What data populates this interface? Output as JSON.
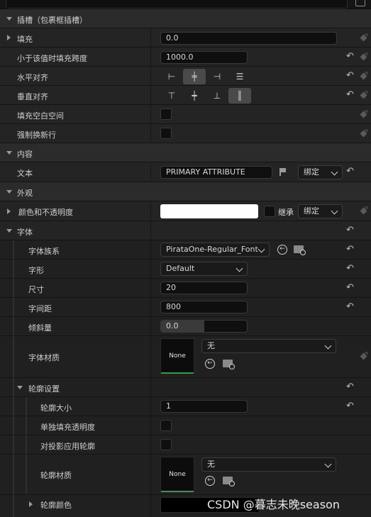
{
  "sections": {
    "slot": "插槽（包裹框插槽）",
    "content": "内容",
    "appearance": "外观"
  },
  "slot": {
    "padding": {
      "label": "填充",
      "value": "0.0"
    },
    "min_span": {
      "label": "小于该值时填充跨度",
      "value": "1000.0"
    },
    "h_align": {
      "label": "水平对齐",
      "options": [
        "left",
        "center",
        "right",
        "fill"
      ],
      "selected": "center"
    },
    "v_align": {
      "label": "垂直对齐",
      "options": [
        "top",
        "center",
        "bottom",
        "fill"
      ],
      "selected": "fill"
    },
    "fill_empty": {
      "label": "填充空白空间",
      "checked": false
    },
    "force_newline": {
      "label": "强制换新行",
      "checked": false
    }
  },
  "content": {
    "text": {
      "label": "文本",
      "value": "PRIMARY ATTRIBUTE",
      "bind_label": "绑定"
    }
  },
  "appearance": {
    "color_opacity": {
      "label": "颜色和不透明度",
      "color": "#ffffff",
      "inherit_label": "继承",
      "bind_label": "绑定"
    },
    "font": {
      "label": "字体",
      "family": {
        "label": "字体族系",
        "value": "PirataOne-Regular_Font"
      },
      "typeface": {
        "label": "字形",
        "value": "Default"
      },
      "size": {
        "label": "尺寸",
        "value": "20"
      },
      "letter_spacing": {
        "label": "字间距",
        "value": "800"
      },
      "skew": {
        "label": "倾斜量",
        "value": "0.0",
        "fraction": 0.5
      },
      "material": {
        "label": "字体材质",
        "thumb_text": "None",
        "select_value": "无"
      },
      "outline": {
        "label": "轮廓设置",
        "size": {
          "label": "轮廓大小",
          "value": "1"
        },
        "separate_fill_alpha": {
          "label": "单独填充透明度",
          "checked": false
        },
        "apply_to_shadows": {
          "label": "对投影应用轮廓",
          "checked": false
        },
        "material": {
          "label": "轮廓材质",
          "thumb_text": "None",
          "select_value": "无"
        },
        "color": {
          "label": "轮廓颜色",
          "color": "#000000"
        }
      }
    }
  },
  "watermark": "CSDN @暮志未晚season",
  "colors": {
    "accent_green": "#2ea043",
    "panel_bg": "#242424",
    "section_bg": "#2b2b2b"
  }
}
